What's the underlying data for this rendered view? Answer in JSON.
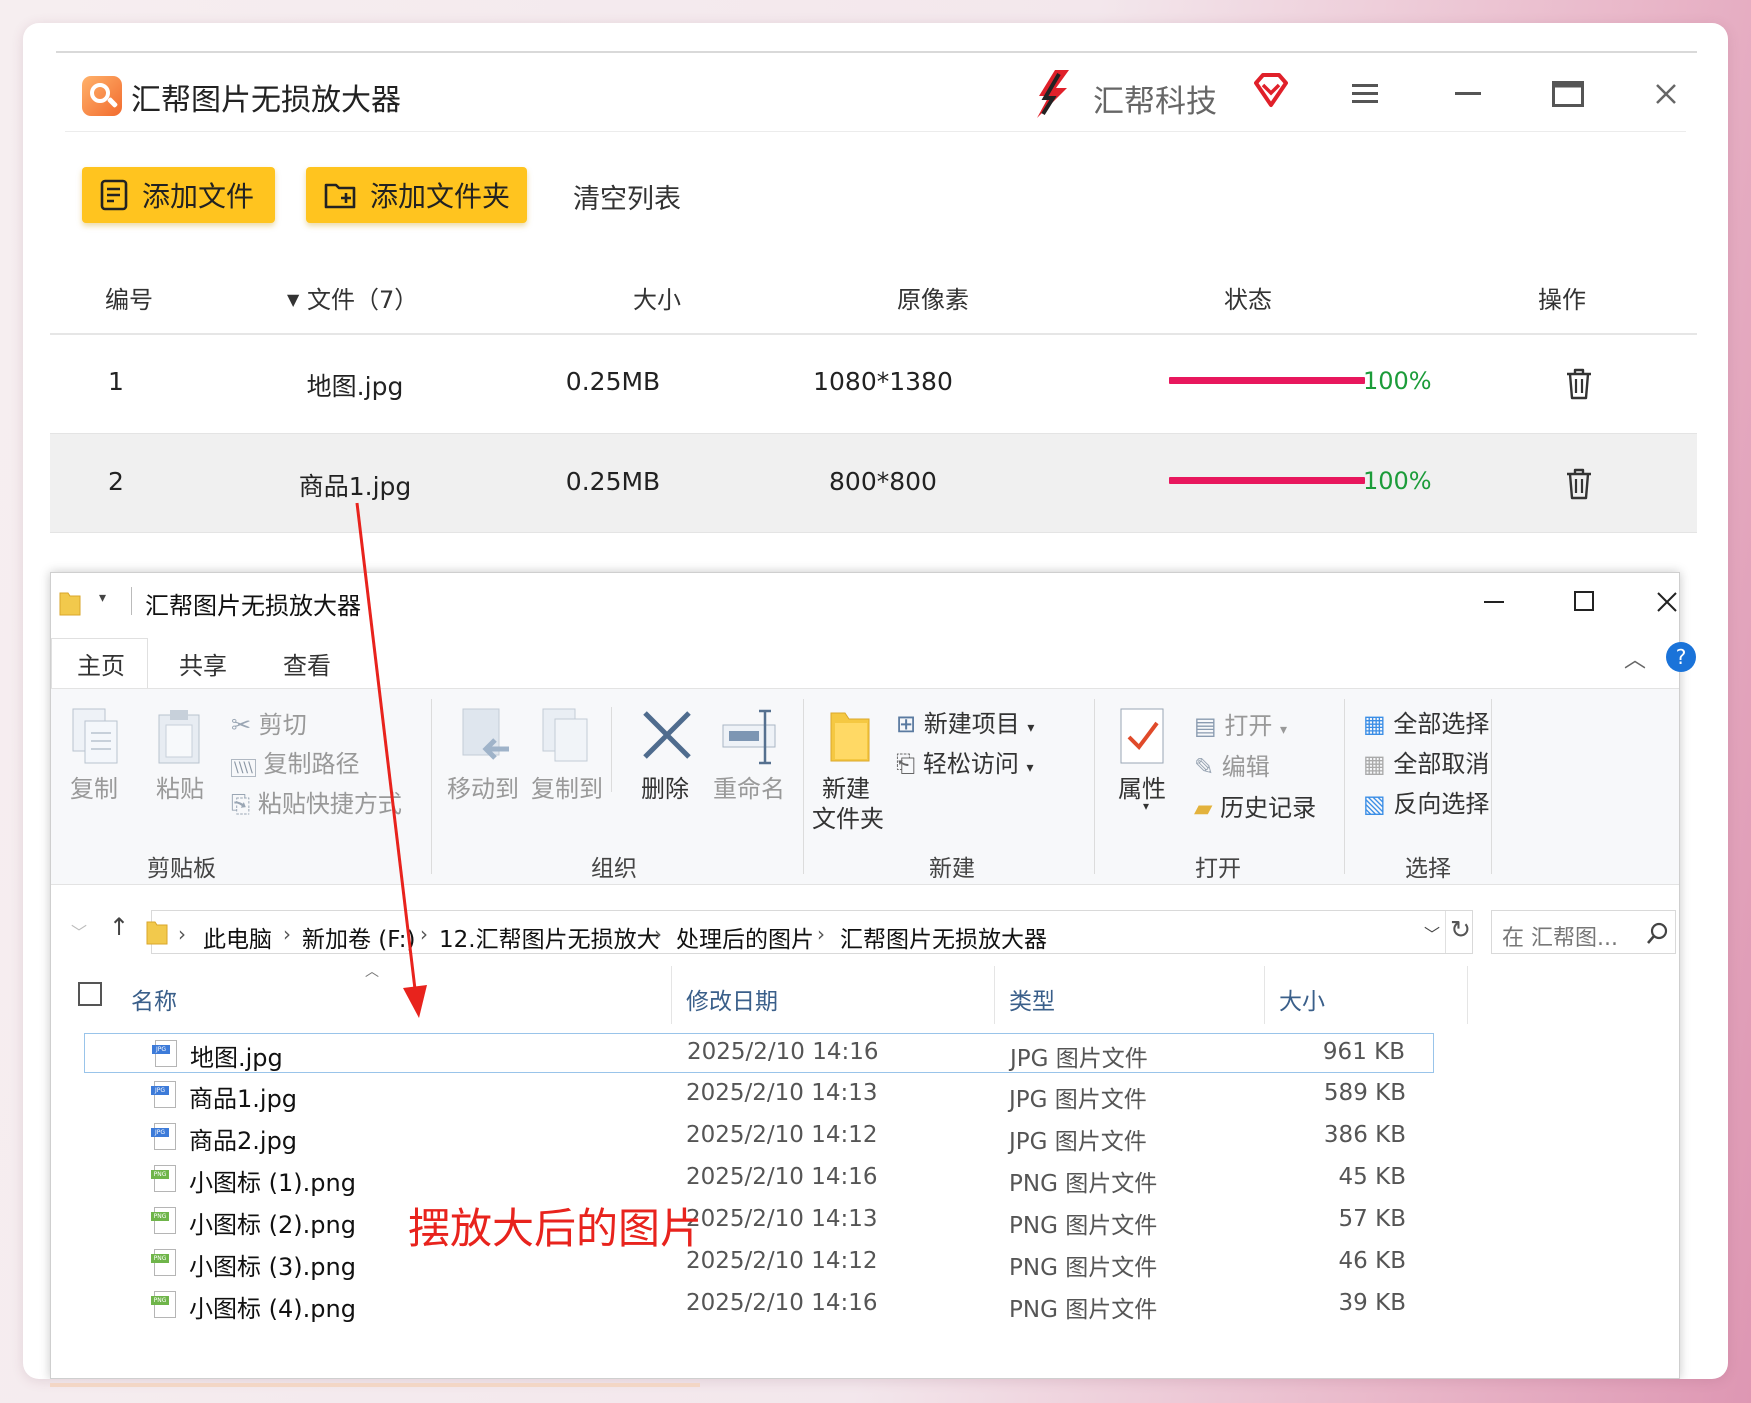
{
  "app": {
    "title": "汇帮图片无损放大器",
    "brand": "汇帮科技",
    "toolbar": {
      "add_file": "添加文件",
      "add_folder": "添加文件夹",
      "clear_list": "清空列表"
    },
    "table": {
      "headers": {
        "id": "编号",
        "file": "文件（7）",
        "size": "大小",
        "pixels": "原像素",
        "status": "状态",
        "action": "操作"
      },
      "rows": [
        {
          "id": "1",
          "name": "地图.jpg",
          "size": "0.25MB",
          "pixels": "1080*1380",
          "progress": 100,
          "progress_label": "100%"
        },
        {
          "id": "2",
          "name": "商品1.jpg",
          "size": "0.25MB",
          "pixels": "800*800",
          "progress": 100,
          "progress_label": "100%"
        }
      ]
    },
    "colors": {
      "accent": "#ffc41f",
      "progress": "#e8175d",
      "percent": "#1c9c3a",
      "annotation": "#e8231d"
    }
  },
  "explorer": {
    "title": "汇帮图片无损放大器",
    "tabs": [
      "主页",
      "共享",
      "查看"
    ],
    "ribbon": {
      "clipboard": {
        "copy": "复制",
        "paste": "粘贴",
        "cut": "剪切",
        "copy_path": "复制路径",
        "paste_shortcut": "粘贴快捷方式",
        "label": "剪贴板"
      },
      "organize": {
        "move_to": "移动到",
        "copy_to": "复制到",
        "delete": "删除",
        "rename": "重命名",
        "label": "组织"
      },
      "new": {
        "new_folder_line1": "新建",
        "new_folder_line2": "文件夹",
        "new_item": "新建项目",
        "easy_access": "轻松访问",
        "label": "新建"
      },
      "open": {
        "properties": "属性",
        "open": "打开",
        "edit": "编辑",
        "history": "历史记录",
        "label": "打开"
      },
      "select": {
        "select_all": "全部选择",
        "select_none": "全部取消",
        "invert": "反向选择",
        "label": "选择"
      }
    },
    "breadcrumb": [
      "此电脑",
      "新加卷 (F:)",
      "12.汇帮图片无损放大",
      "处理后的图片",
      "汇帮图片无损放大器"
    ],
    "search_placeholder": "在 汇帮图...",
    "columns": {
      "name": "名称",
      "date": "修改日期",
      "type": "类型",
      "size": "大小"
    },
    "files": [
      {
        "name": "地图.jpg",
        "date": "2025/2/10 14:16",
        "type": "JPG 图片文件",
        "size": "961 KB",
        "kind": "JPG"
      },
      {
        "name": "商品1.jpg",
        "date": "2025/2/10 14:13",
        "type": "JPG 图片文件",
        "size": "589 KB",
        "kind": "JPG"
      },
      {
        "name": "商品2.jpg",
        "date": "2025/2/10 14:12",
        "type": "JPG 图片文件",
        "size": "386 KB",
        "kind": "JPG"
      },
      {
        "name": "小图标 (1).png",
        "date": "2025/2/10 14:16",
        "type": "PNG 图片文件",
        "size": "45 KB",
        "kind": "PNG"
      },
      {
        "name": "小图标 (2).png",
        "date": "2025/2/10 14:13",
        "type": "PNG 图片文件",
        "size": "57 KB",
        "kind": "PNG"
      },
      {
        "name": "小图标 (3).png",
        "date": "2025/2/10 14:12",
        "type": "PNG 图片文件",
        "size": "46 KB",
        "kind": "PNG"
      },
      {
        "name": "小图标 (4).png",
        "date": "2025/2/10 14:16",
        "type": "PNG 图片文件",
        "size": "39 KB",
        "kind": "PNG"
      }
    ]
  },
  "annotation": "摆放大后的图片"
}
